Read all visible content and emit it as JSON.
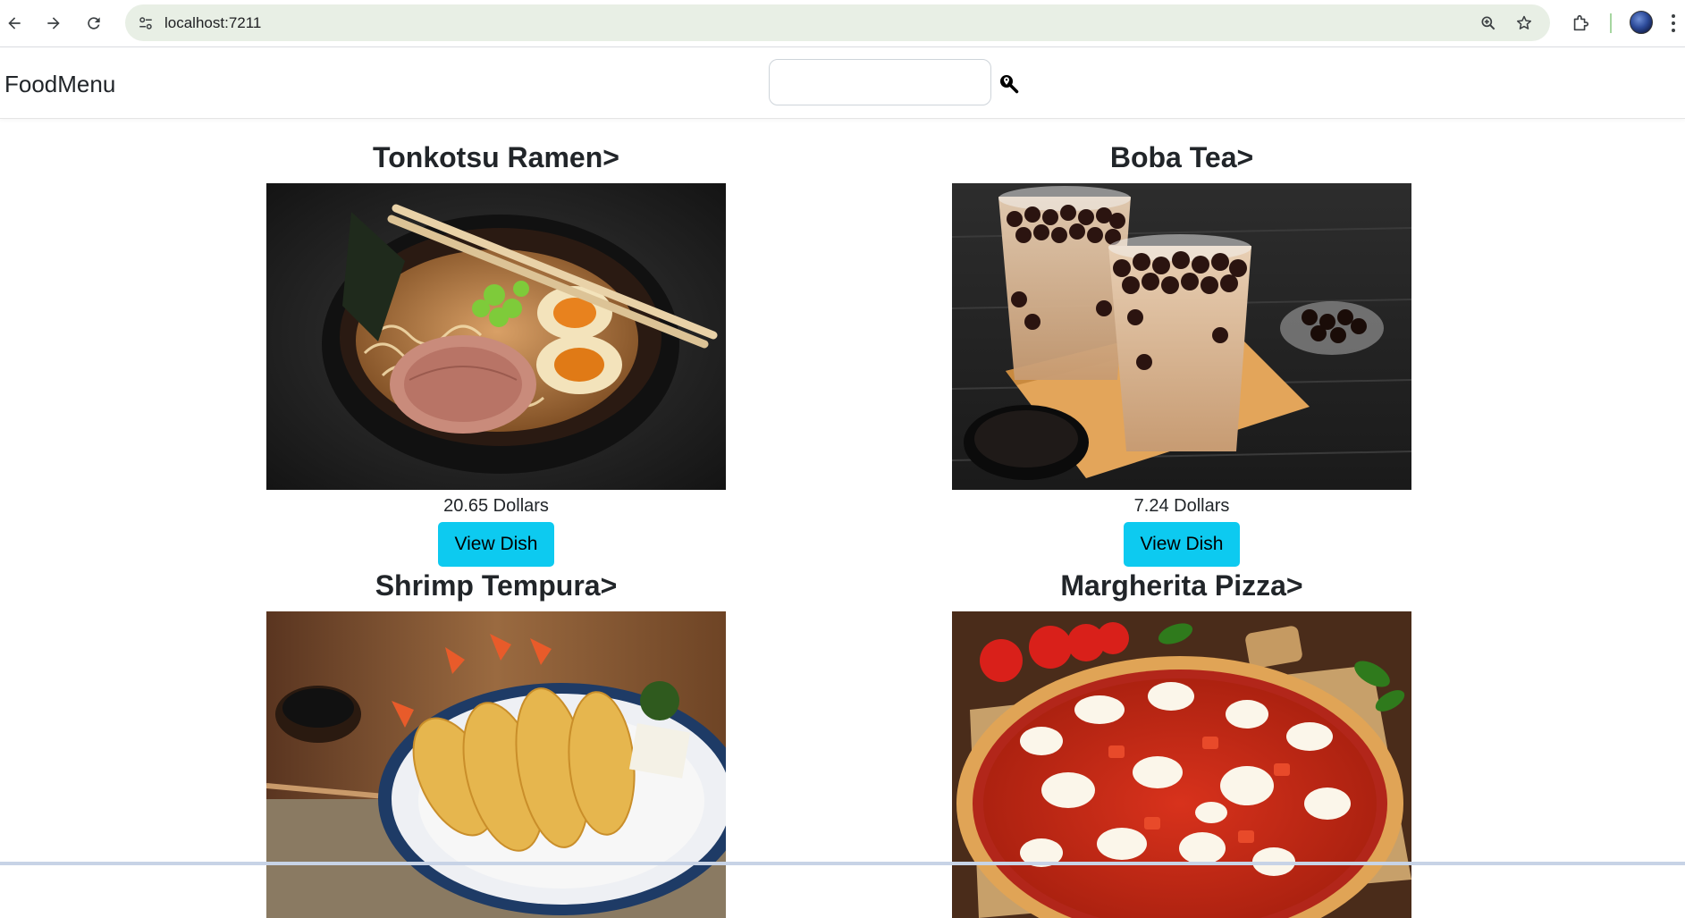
{
  "browser": {
    "url": "localhost:7211",
    "back_icon": "arrow-left-icon",
    "forward_icon": "arrow-right-icon",
    "reload_icon": "reload-icon",
    "site_info_icon": "tune-icon",
    "zoom_icon": "zoom-in-icon",
    "bookmark_icon": "star-icon",
    "extensions_icon": "puzzle-icon",
    "menu_icon": "kebab-icon"
  },
  "navbar": {
    "brand": "FoodMenu",
    "search_placeholder": "",
    "search_value": "",
    "search_icon": "magnify-location-icon"
  },
  "dishes": [
    {
      "name": "Tonkotsu Ramen>",
      "price": "20.65 Dollars",
      "button": "View Dish",
      "image": "tonkotsu-ramen-photo"
    },
    {
      "name": "Boba Tea>",
      "price": "7.24 Dollars",
      "button": "View Dish",
      "image": "boba-tea-photo"
    },
    {
      "name": "Shrimp Tempura>",
      "price": "",
      "button": "",
      "image": "shrimp-tempura-photo"
    },
    {
      "name": "Margherita Pizza>",
      "price": "",
      "button": "",
      "image": "margherita-pizza-photo"
    }
  ],
  "colors": {
    "button_bg": "#0dcaf0",
    "omnibox_bg": "#e8efe5",
    "text": "#212529"
  }
}
